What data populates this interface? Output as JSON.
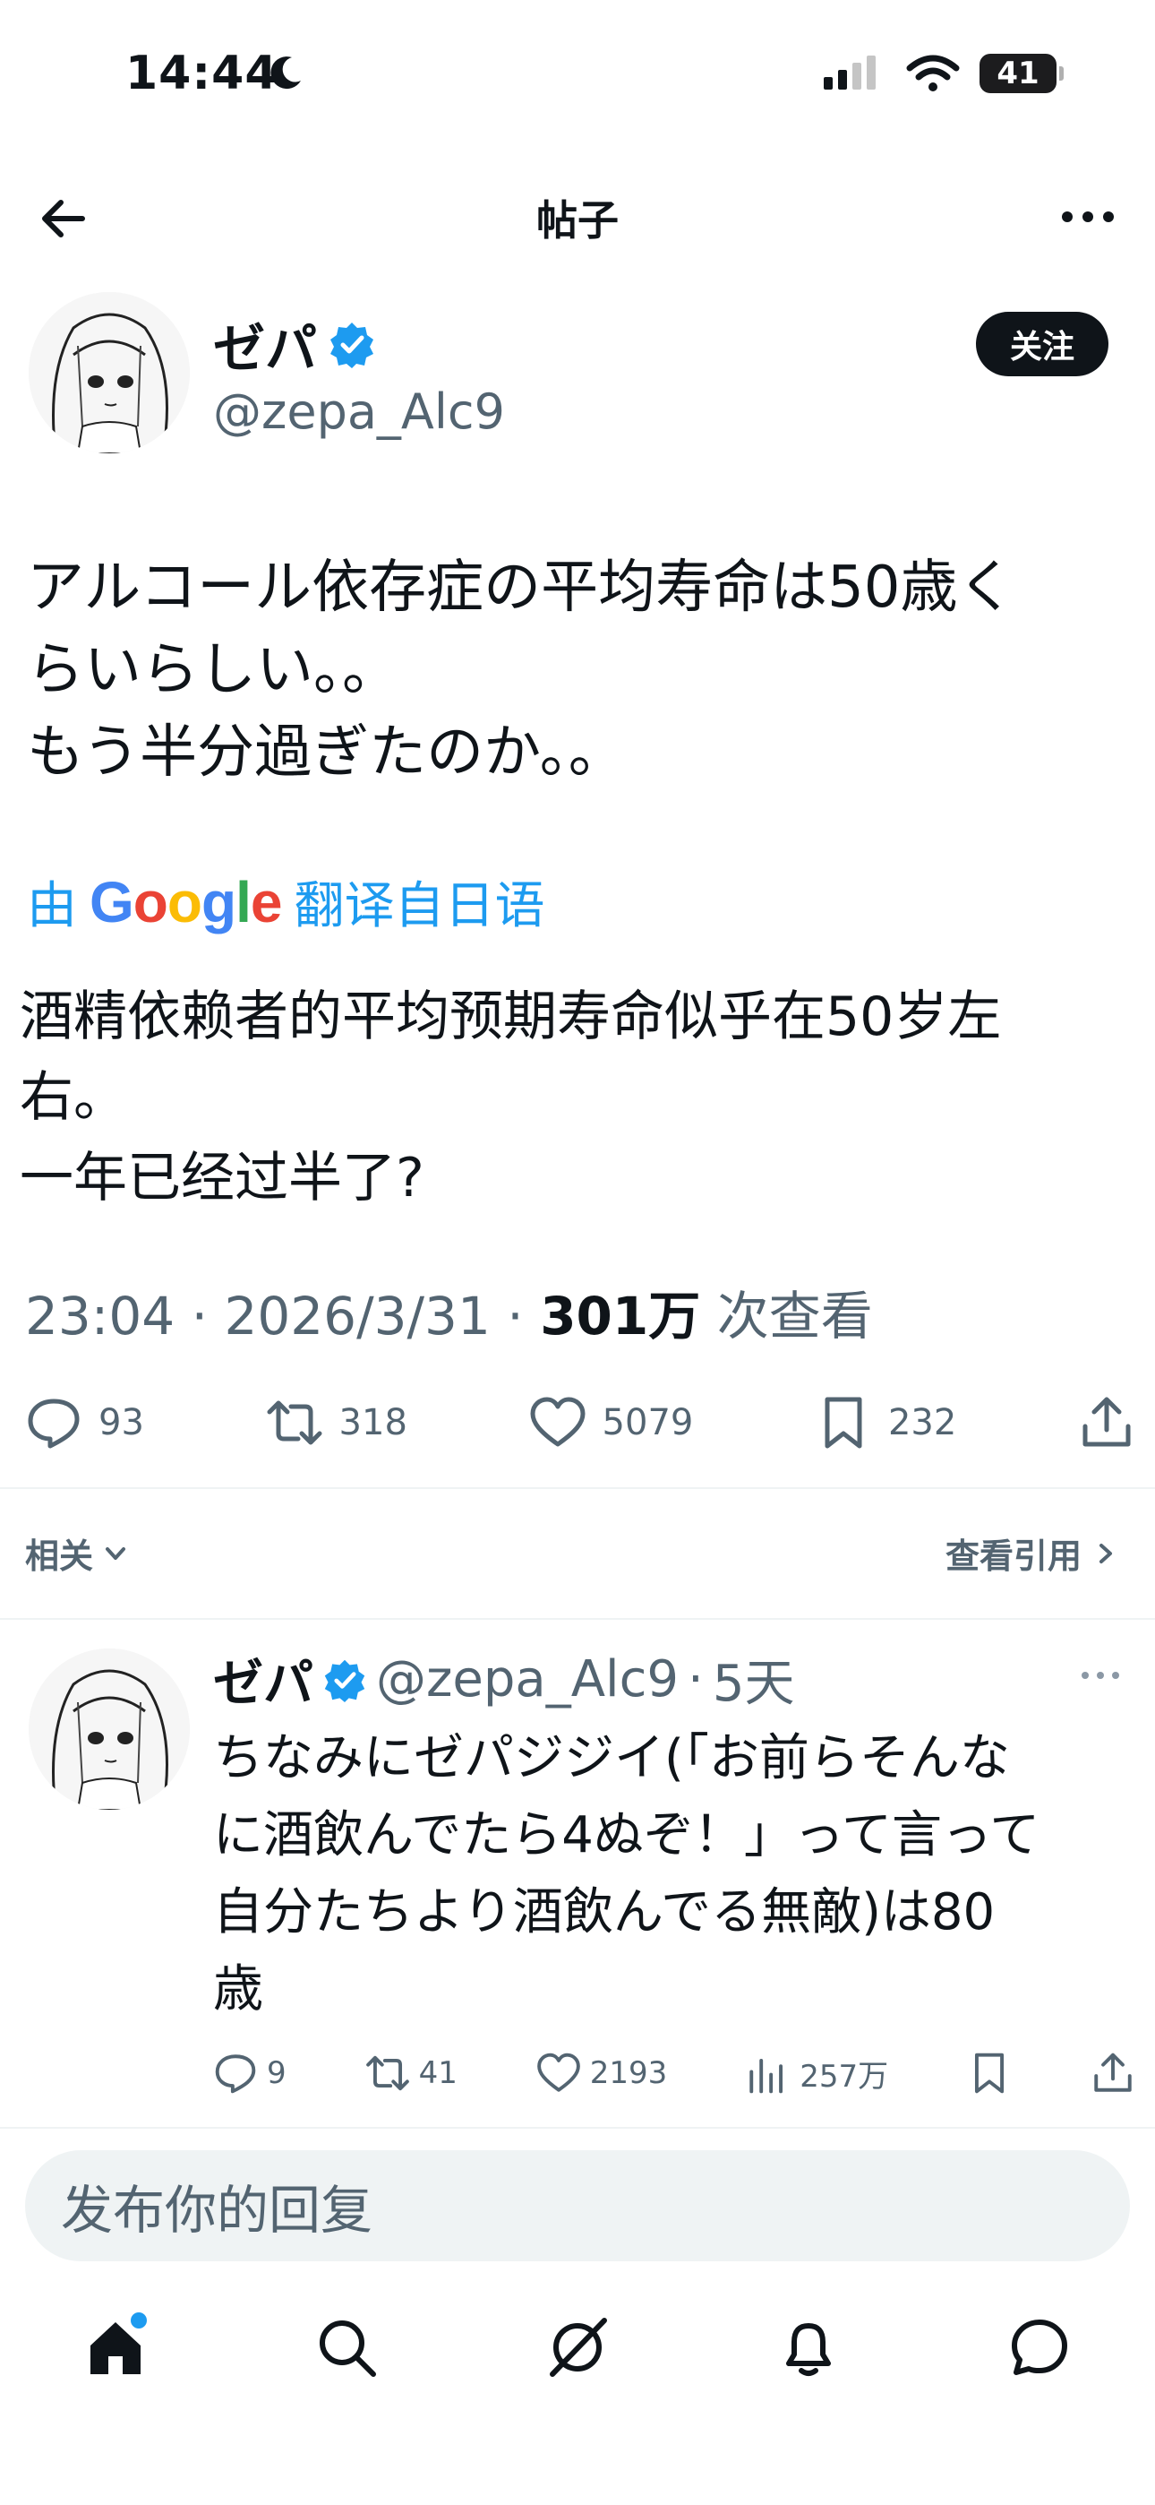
{
  "status_bar": {
    "time": "14:44",
    "battery": "41"
  },
  "header": {
    "title": "帖子"
  },
  "tweet": {
    "author_name": "ゼパ",
    "author_handle": "@zepa_Alc9",
    "follow_label": "关注",
    "text": "アルコール依存症の平均寿命は50歳く\nらいらしい。。\nもう半分過ぎたのか。。",
    "translate_prefix": "由",
    "translate_brand": "Google",
    "translate_suffix": "翻译自日语",
    "translated_text": "酒精依赖者的平均预期寿命似乎在50岁左\n右。\n一年已经过半了?",
    "time": "23:04",
    "date": "2026/3/31",
    "views_count": "301万",
    "views_label": "次查看",
    "stats": {
      "replies": "93",
      "retweets": "318",
      "likes": "5079",
      "bookmarks": "232"
    }
  },
  "related": {
    "label": "相关",
    "quotes_label": "查看引用"
  },
  "reply": {
    "author_name": "ゼパ",
    "author_handle": "@zepa_Alc9",
    "time_ago": "5天",
    "text": "ちなみにゼパジジイ(「お前らそんな\nに酒飲んでたら4ぬぞ！」って言って\n自分たちより酒飲んでる無敵)は80\n歳",
    "stats": {
      "replies": "9",
      "retweets": "41",
      "likes": "2193",
      "views": "257万"
    }
  },
  "reply_input": {
    "placeholder": "发布你的回复"
  },
  "colors": {
    "accent": "#1d9bf0",
    "text": "#0f1419",
    "muted": "#536471"
  },
  "tabbar": {
    "items": [
      "home-icon",
      "search-icon",
      "grok-icon",
      "bell-icon",
      "messages-icon"
    ]
  }
}
